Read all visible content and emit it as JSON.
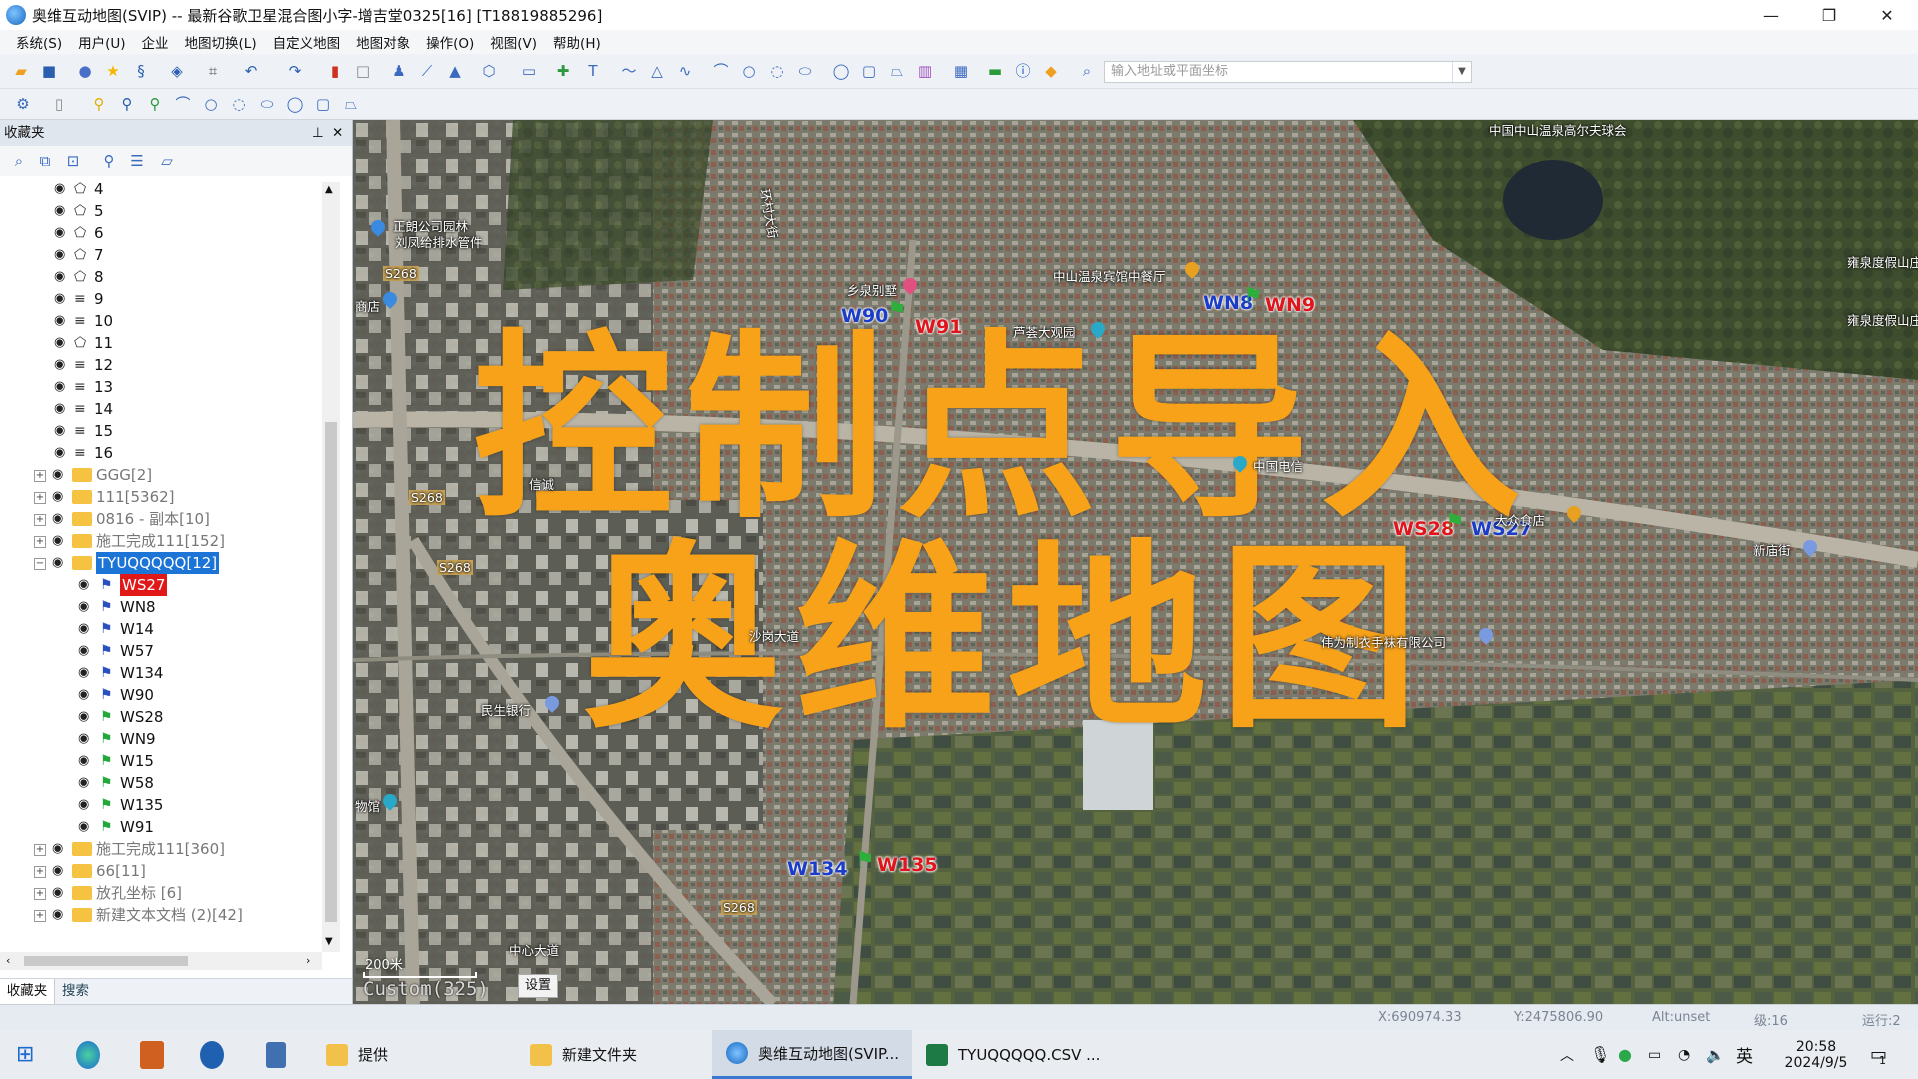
{
  "window": {
    "title": "奥维互动地图(SVIP) -- 最新谷歌卫星混合图小字-增吉堂0325[16] [T18819885296]",
    "controls": {
      "minimize": "—",
      "restore": "❐",
      "close": "✕"
    }
  },
  "menu": [
    "系统(S)",
    "用户(U)",
    "企业",
    "地图切换(L)",
    "自定义地图",
    "地图对象",
    "操作(O)",
    "视图(V)",
    "帮助(H)"
  ],
  "toolbar": {
    "search_placeholder": "输入地址或平面坐标"
  },
  "panel": {
    "title": "收藏夹",
    "pin_glyph": "⊥",
    "close_glyph": "✕",
    "tree": [
      {
        "label": "4",
        "kind": "poly",
        "depth": 1
      },
      {
        "label": "5",
        "kind": "poly",
        "depth": 1
      },
      {
        "label": "6",
        "kind": "poly",
        "depth": 1
      },
      {
        "label": "7",
        "kind": "poly",
        "depth": 1
      },
      {
        "label": "8",
        "kind": "poly",
        "depth": 1
      },
      {
        "label": "9",
        "kind": "line",
        "depth": 1
      },
      {
        "label": "10",
        "kind": "line",
        "depth": 1
      },
      {
        "label": "11",
        "kind": "poly",
        "depth": 1
      },
      {
        "label": "12",
        "kind": "line",
        "depth": 1
      },
      {
        "label": "13",
        "kind": "line",
        "depth": 1
      },
      {
        "label": "14",
        "kind": "line",
        "depth": 1
      },
      {
        "label": "15",
        "kind": "line",
        "depth": 1
      },
      {
        "label": "16",
        "kind": "line",
        "depth": 1
      },
      {
        "label": "GGG[2]",
        "kind": "folder",
        "depth": 0
      },
      {
        "label": "111[5362]",
        "kind": "folder",
        "depth": 0
      },
      {
        "label": "0816 - 副本[10]",
        "kind": "folder",
        "depth": 0
      },
      {
        "label": "施工完成111[152]",
        "kind": "folder",
        "depth": 0
      },
      {
        "label": "TYUQQQQQ[12]",
        "kind": "folder-open",
        "depth": 0,
        "selected": true
      },
      {
        "label": "WS27",
        "kind": "pin-blue",
        "depth": 2,
        "highlight": true
      },
      {
        "label": "WN8",
        "kind": "pin-blue",
        "depth": 2
      },
      {
        "label": "W14",
        "kind": "pin-blue",
        "depth": 2
      },
      {
        "label": "W57",
        "kind": "pin-blue",
        "depth": 2
      },
      {
        "label": "W134",
        "kind": "pin-blue",
        "depth": 2
      },
      {
        "label": "W90",
        "kind": "pin-blue",
        "depth": 2
      },
      {
        "label": "WS28",
        "kind": "pin-green",
        "depth": 2
      },
      {
        "label": "WN9",
        "kind": "pin-green",
        "depth": 2
      },
      {
        "label": "W15",
        "kind": "pin-green",
        "depth": 2
      },
      {
        "label": "W58",
        "kind": "pin-green",
        "depth": 2
      },
      {
        "label": "W135",
        "kind": "pin-green",
        "depth": 2
      },
      {
        "label": "W91",
        "kind": "pin-green",
        "depth": 2
      },
      {
        "label": "施工完成111[360]",
        "kind": "folder",
        "depth": 0
      },
      {
        "label": "66[11]",
        "kind": "folder",
        "depth": 0
      },
      {
        "label": "放孔坐标 [6]",
        "kind": "folder",
        "depth": 0
      },
      {
        "label": "新建文本文档 (2)[42]",
        "kind": "folder",
        "depth": 0
      }
    ],
    "tabs": [
      "收藏夹",
      "搜索"
    ]
  },
  "map": {
    "overlay_line1": "控制点导入",
    "overlay_line2": "奥维地图",
    "control_points": [
      {
        "label": "W90",
        "color": "blue"
      },
      {
        "label": "W91",
        "color": "red"
      },
      {
        "label": "WN8",
        "color": "blue"
      },
      {
        "label": "WN9",
        "color": "red"
      },
      {
        "label": "WS28",
        "color": "red"
      },
      {
        "label": "WS27",
        "color": "blue"
      },
      {
        "label": "W134",
        "color": "blue"
      },
      {
        "label": "W135",
        "color": "red"
      }
    ],
    "pois": [
      "正朗公司园林",
      "刘凤给排水管件",
      "商店",
      "乡泉别墅",
      "芦荟大观园",
      "中山温泉宾馆中餐厅",
      "雍泉度假山庄停",
      "雍泉度假山庄",
      "中国电信",
      "大众食店",
      "新庙街",
      "民生银行",
      "伟为制衣手袜有限公司",
      "物馆",
      "中国中山温泉高尔夫球会",
      "信诚",
      "环村大街",
      "沙岗大道",
      "中心大道"
    ],
    "road_tags": [
      "S268",
      "S268",
      "S268",
      "S268"
    ],
    "scale": "200米",
    "custom_label": "Custom(325)",
    "settings_button": "设置"
  },
  "status": {
    "x": "X:690974.33",
    "y": "Y:2475806.90",
    "alt": "Alt:unset",
    "level": "级:16",
    "running": "运行:2"
  },
  "taskbar": {
    "items": [
      "提供",
      "新建文件夹",
      "奥维互动地图(SVIP...",
      "TYUQQQQQ.CSV ..."
    ],
    "ime": "英",
    "time": "20:58",
    "date": "2024/9/5",
    "notifications": "1"
  }
}
